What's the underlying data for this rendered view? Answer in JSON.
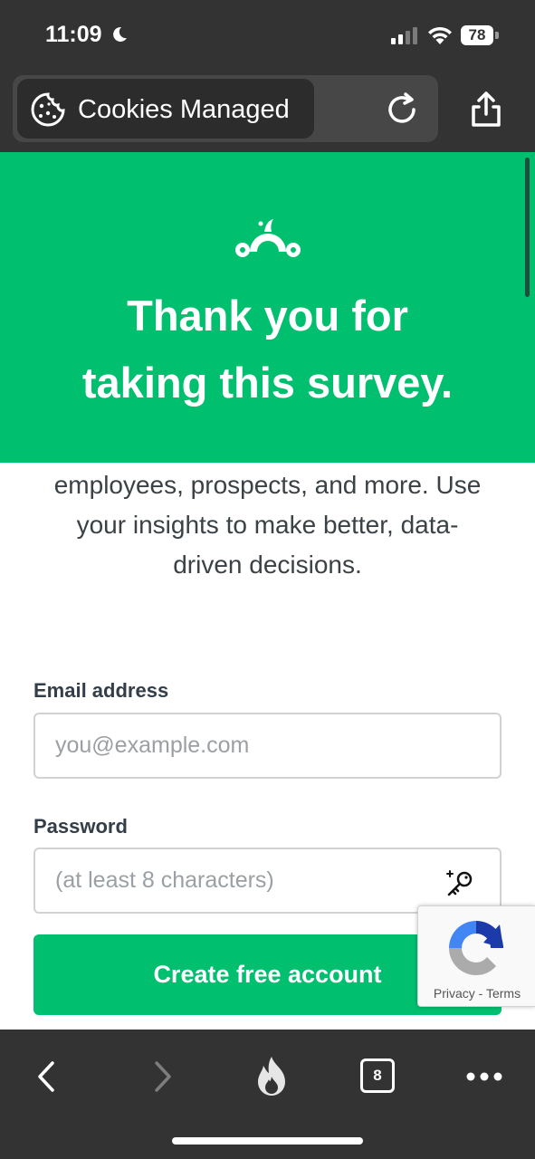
{
  "status_bar": {
    "time": "11:09",
    "battery": "78",
    "icons": [
      "moon-icon",
      "signal-icon",
      "wifi-icon",
      "battery-icon"
    ]
  },
  "browser": {
    "cookie_label": "Cookies Managed",
    "icons": [
      "cookie-icon",
      "reload-icon",
      "share-icon"
    ],
    "tab_count": "8",
    "toolbar_icons": [
      "back-icon",
      "forward-icon",
      "fire-icon",
      "tabs-icon",
      "more-icon"
    ]
  },
  "banner": {
    "title_line1": "Thank you for",
    "title_line2": "taking this survey.",
    "color": "#00bf6f",
    "logo": "surveymonkey-logo-icon"
  },
  "intro": {
    "line1": "employees, prospects, and more. Use",
    "line2": "your insights to make better, data-",
    "line3": "driven decisions."
  },
  "form": {
    "email_label": "Email address",
    "email_placeholder": "you@example.com",
    "password_label": "Password",
    "password_placeholder": "(at least 8 characters)",
    "submit_label": "Create free account"
  },
  "recaptcha": {
    "privacy": "Privacy",
    "separator": " - ",
    "terms": "Terms"
  }
}
